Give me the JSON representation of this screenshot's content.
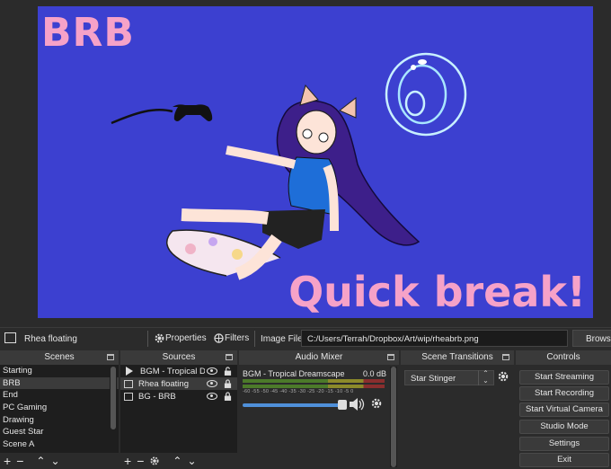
{
  "preview": {
    "brb_text": "BRB",
    "caption": "Quick break!",
    "background_color": "#3c40d0",
    "text_color": "#f6a2c8"
  },
  "source_toolbar": {
    "source_name": "Rhea floating",
    "properties_label": "Properties",
    "filters_label": "Filters",
    "image_file_label": "Image File",
    "path_value": "C:/Users/Terrah/Dropbox/Art/wip/rheabrb.png",
    "browse_label": "Browse"
  },
  "scenes": {
    "title": "Scenes",
    "items": [
      "Starting",
      "BRB",
      "End",
      "PC Gaming",
      "Drawing",
      "Guest Star",
      "Scene A"
    ],
    "selected": "BRB"
  },
  "sources": {
    "title": "Sources",
    "items": [
      {
        "name": "BGM - Tropical Dre",
        "type_icon": "play-icon"
      },
      {
        "name": "Rhea floating",
        "type_icon": "image-icon"
      },
      {
        "name": "BG - BRB",
        "type_icon": "image-icon"
      }
    ]
  },
  "mixer": {
    "title": "Audio Mixer",
    "channel_name": "BGM - Tropical Dreamscape",
    "level": "0.0 dB",
    "ticks": "-60 -55 -50 -45 -40 -35 -30 -25 -20 -15 -10 -5 0",
    "volume_fraction": 0.95
  },
  "transitions": {
    "title": "Scene Transitions",
    "selected": "Star Stinger"
  },
  "controls": {
    "title": "Controls",
    "buttons": [
      "Start Streaming",
      "Start Recording",
      "Start Virtual Camera",
      "Studio Mode",
      "Settings",
      "Exit"
    ]
  }
}
